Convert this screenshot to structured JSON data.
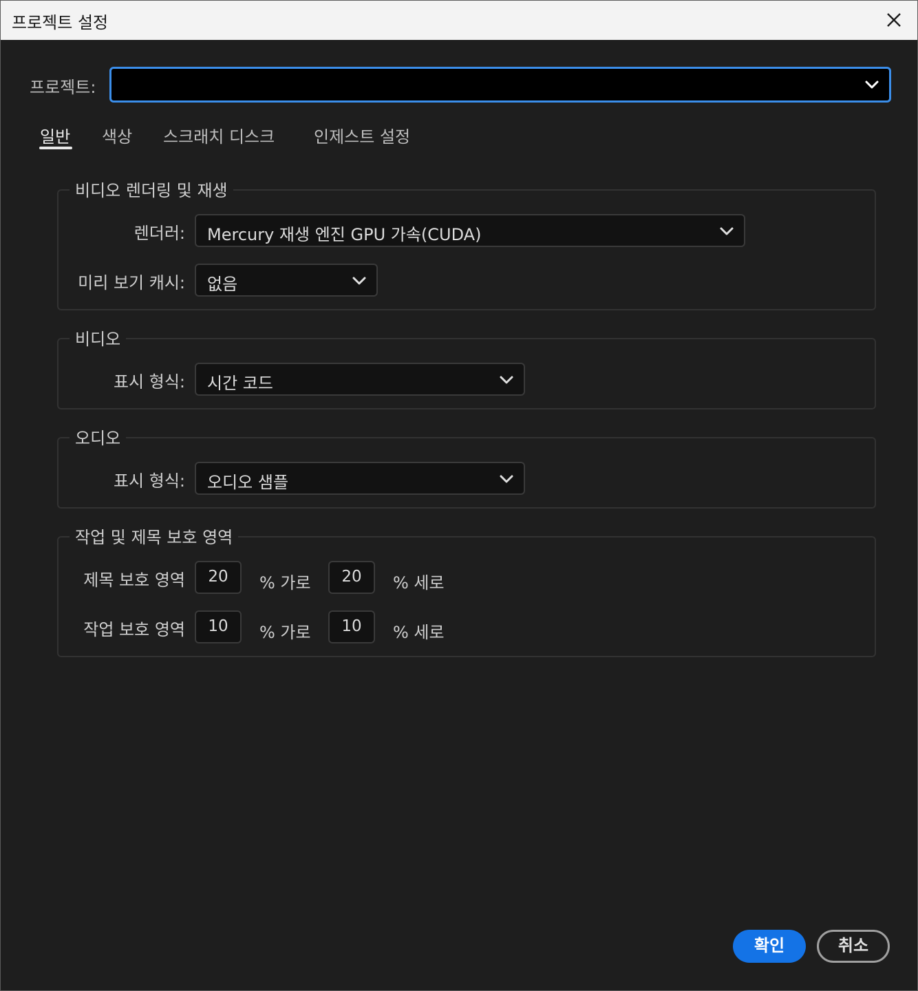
{
  "window": {
    "title": "프로젝트 설정"
  },
  "project": {
    "label": "프로젝트:",
    "value": ""
  },
  "tabs": [
    {
      "label": "일반",
      "active": true
    },
    {
      "label": "색상"
    },
    {
      "label": "스크래치 디스크"
    },
    {
      "label": "인제스트 설정"
    }
  ],
  "rendering": {
    "legend": "비디오 렌더링 및 재생",
    "renderer_label": "렌더러:",
    "renderer_value": "Mercury 재생 엔진 GPU 가속(CUDA)",
    "preview_cache_label": "미리 보기 캐시:",
    "preview_cache_value": "없음"
  },
  "video": {
    "legend": "비디오",
    "display_format_label": "표시 형식:",
    "display_format_value": "시간 코드"
  },
  "audio": {
    "legend": "오디오",
    "display_format_label": "표시 형식:",
    "display_format_value": "오디오 샘플"
  },
  "safe_margins": {
    "legend": "작업 및 제목 보호 영역",
    "title_safe": {
      "label": "제목 보호 영역",
      "horizontal": "20",
      "horizontal_unit": "% 가로",
      "vertical": "20",
      "vertical_unit": "% 세로"
    },
    "action_safe": {
      "label": "작업 보호 영역",
      "horizontal": "10",
      "horizontal_unit": "% 가로",
      "vertical": "10",
      "vertical_unit": "% 세로"
    }
  },
  "buttons": {
    "ok": "확인",
    "cancel": "취소"
  },
  "colors": {
    "accent": "#1473e6",
    "focus_border": "#3b8eea",
    "background": "#1e1e1e"
  }
}
